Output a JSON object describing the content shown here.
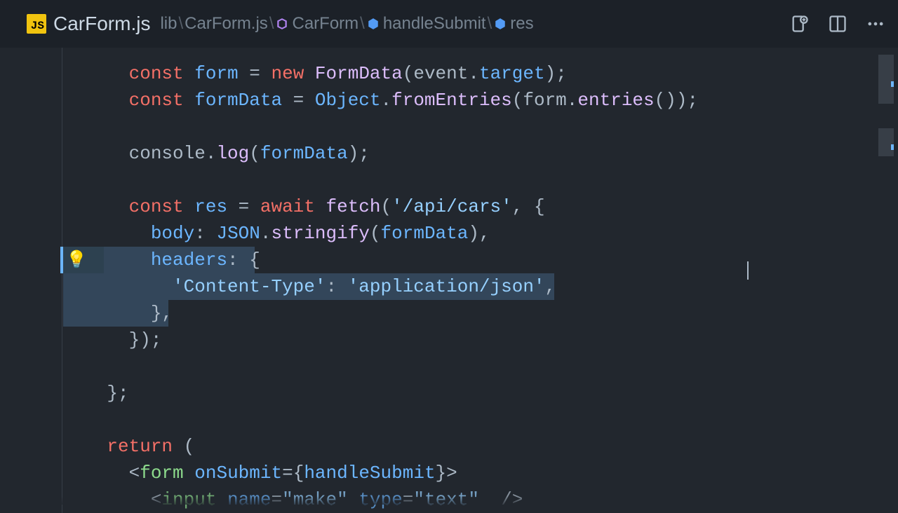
{
  "tab": {
    "file_icon_text": "JS",
    "filename": "CarForm.js"
  },
  "breadcrumb": {
    "p1": "lib",
    "p2": "CarForm.js",
    "p3": "CarForm",
    "p4": "handleSubmit",
    "p5": "res"
  },
  "code": {
    "l1": {
      "kw": "const",
      "var": "form",
      "eq": " = ",
      "new": "new",
      "type": "FormData",
      "open": "(",
      "arg1": "event",
      "dot": ".",
      "arg2": "target",
      "close": ");"
    },
    "l2": {
      "kw": "const",
      "var": "formData",
      "eq": " = ",
      "obj": "Object",
      "dot": ".",
      "fn": "fromEntries",
      "open": "(",
      "arg1": "form",
      "dot2": ".",
      "fn2": "entries",
      "parens": "()",
      "close": ");"
    },
    "l3": {
      "obj": "console",
      "dot": ".",
      "fn": "log",
      "open": "(",
      "arg": "formData",
      "close": ");"
    },
    "l4": {
      "kw": "const",
      "var": "res",
      "eq": " = ",
      "await": "await",
      "fn": "fetch",
      "open": "(",
      "str": "'/api/cars'",
      "comma": ", {"
    },
    "l5": {
      "prop": "body",
      "colon": ": ",
      "obj": "JSON",
      "dot": ".",
      "fn": "stringify",
      "open": "(",
      "arg": "formData",
      "close": "),"
    },
    "l6": {
      "prop": "headers",
      "colon": ": {",
      "dots": "· · · · · ·"
    },
    "l7": {
      "key": "'Content-Type'",
      "colon": ": ",
      "val": "'application/json'",
      "comma": ","
    },
    "l8": {
      "close": "},"
    },
    "l9": {
      "close": "});"
    },
    "l10": {
      "close": "};"
    },
    "l11": {
      "kw": "return",
      "open": " ("
    },
    "l12": {
      "lt": "<",
      "tag": "form",
      "attr": "onSubmit",
      "eq": "=",
      "brace": "{",
      "val": "handleSubmit",
      "brace2": "}",
      "gt": ">"
    },
    "l13": {
      "lt": "<",
      "tag": "input",
      "attr1": "name",
      "eq1": "=",
      "val1": "\"make\"",
      "attr2": "type",
      "eq2": "=",
      "val2": "\"text\"",
      "end": "  />"
    }
  }
}
